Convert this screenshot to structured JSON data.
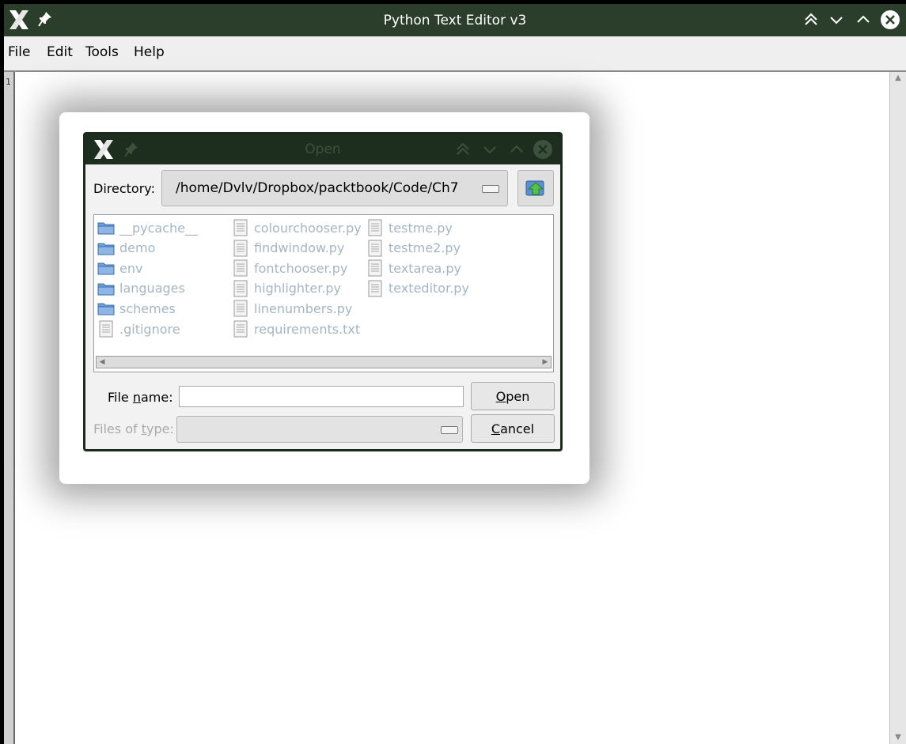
{
  "window": {
    "title": "Python Text Editor v3",
    "colors": {
      "titlebar": "#2b3e2b",
      "menubar": "#efefef"
    }
  },
  "menu": {
    "items": [
      "File",
      "Edit",
      "Tools",
      "Help"
    ]
  },
  "editor": {
    "line_numbers": [
      "1"
    ],
    "content": ""
  },
  "dialog": {
    "title": "Open",
    "directory_label": "Directory:",
    "directory_value": "/home/Dvlv/Dropbox/packtbook/Code/Ch7",
    "folders": [
      "__pycache__",
      "demo",
      "env",
      "languages",
      "schemes"
    ],
    "files": [
      ".gitignore",
      "colourchooser.py",
      "findwindow.py",
      "fontchooser.py",
      "highlighter.py",
      "linenumbers.py",
      "requirements.txt",
      "testme.py",
      "testme2.py",
      "textarea.py",
      "texteditor.py"
    ],
    "file_name_label": "File name:",
    "file_name_value": "",
    "files_of_type_label": "Files of type:",
    "files_of_type_value": "",
    "open_label": "Open",
    "cancel_label": "Cancel"
  }
}
